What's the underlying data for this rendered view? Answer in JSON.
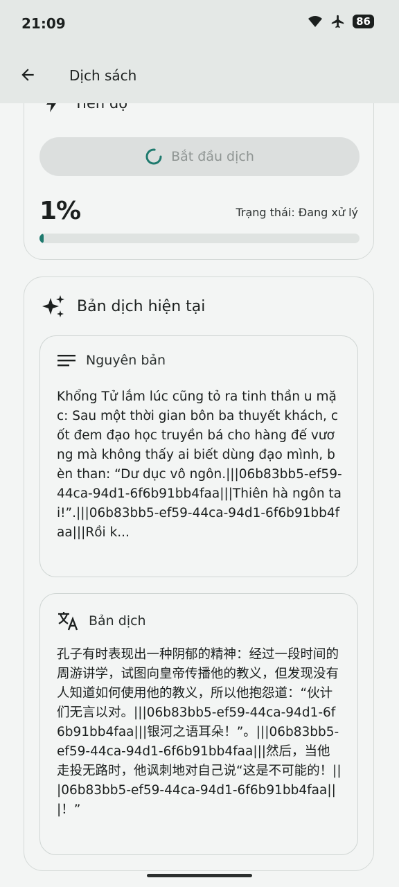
{
  "status_bar": {
    "time": "21:09",
    "battery": "86"
  },
  "app_bar": {
    "title": "Dịch sách"
  },
  "progress_card": {
    "heading": "Tiến độ",
    "start_button": "Bắt đầu dịch",
    "percent": "1%",
    "status": "Trạng thái: Đang xử lý",
    "progress_fraction": 0.01
  },
  "translation_card": {
    "heading": "Bản dịch hiện tại",
    "original": {
      "label": "Nguyên bản",
      "text": "Khổng Tử lắm lúc cũng tỏ ra tinh thần u mặc: Sau một thời gian bôn ba thuyết khách, cốt đem đạo học truyền bá cho hàng đế vương mà không thấy ai biết dùng đạo mình, bèn than: “Dư dục vô ngôn.|||06b83bb5-ef59-44ca-94d1-6f6b91bb4faa|||Thiên hà ngôn tai!”.|||06b83bb5-ef59-44ca-94d1-6f6b91bb4faa|||Rồi k..."
    },
    "translated": {
      "label": "Bản dịch",
      "text": "孔子有时表现出一种阴郁的精神：经过一段时间的周游讲学，试图向皇帝传播他的教义，但发现没有人知道如何使用他的教义，所以他抱怨道：“伙计们无言以对。|||06b83bb5-ef59-44ca-94d1-6f6b91bb4faa|||银河之语耳朵！”。|||06b83bb5-ef59-44ca-94d1-6f6b91bb4faa|||然后，当他走投无路时，他讽刺地对自己说“这是不可能的！|||06b83bb5-ef59-44ca-94d1-6f6b91bb4faa|||！”"
    }
  }
}
